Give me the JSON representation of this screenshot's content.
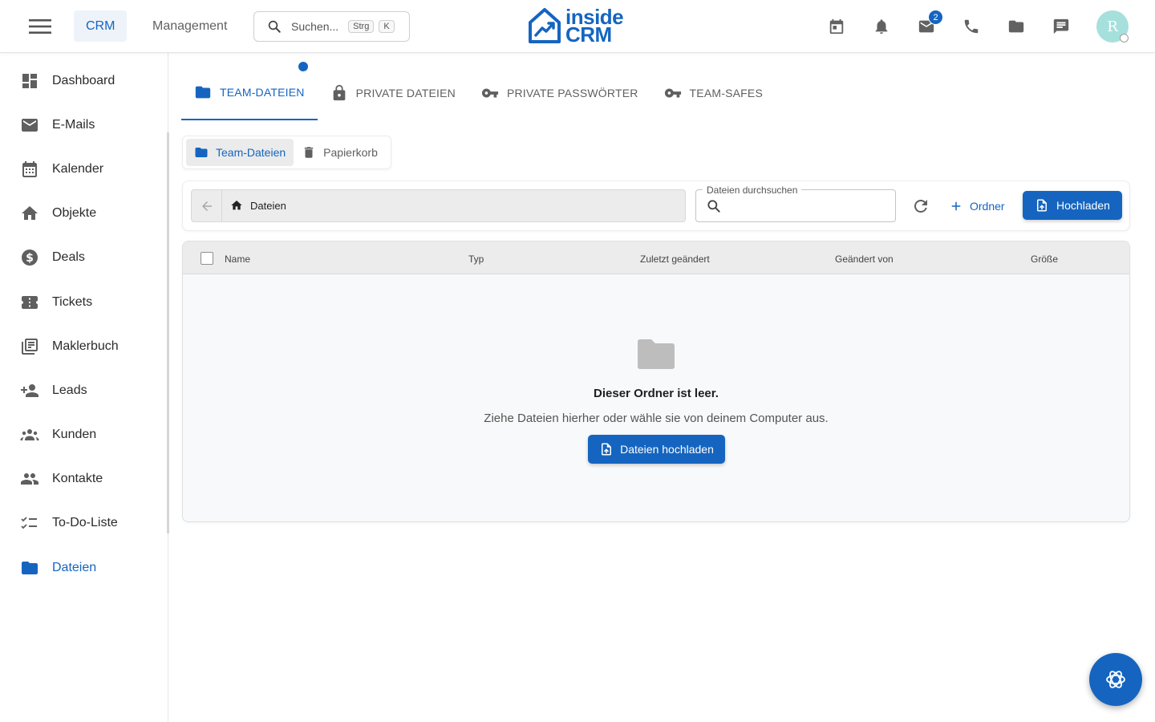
{
  "topbar": {
    "nav_tabs": [
      {
        "label": "CRM",
        "active": true
      },
      {
        "label": "Management",
        "active": false
      }
    ],
    "search": {
      "placeholder": "Suchen...",
      "shortcut_mod": "Strg",
      "shortcut_key": "K"
    },
    "logo": {
      "line1": "inside",
      "line2": "CRM"
    },
    "icons": [
      "calendar-icon",
      "bell-icon",
      "mail-icon",
      "phone-icon",
      "folder-icon",
      "chat-icon"
    ],
    "mail_badge": "2",
    "avatar_initial": "R"
  },
  "sidebar": {
    "items": [
      {
        "label": "Dashboard",
        "icon": "dashboard-icon"
      },
      {
        "label": "E-Mails",
        "icon": "mail-icon"
      },
      {
        "label": "Kalender",
        "icon": "calendar-icon"
      },
      {
        "label": "Objekte",
        "icon": "house-icon"
      },
      {
        "label": "Deals",
        "icon": "dollar-icon"
      },
      {
        "label": "Tickets",
        "icon": "ticket-icon"
      },
      {
        "label": "Maklerbuch",
        "icon": "library-icon"
      },
      {
        "label": "Leads",
        "icon": "person-add-icon"
      },
      {
        "label": "Kunden",
        "icon": "groups-icon"
      },
      {
        "label": "Kontakte",
        "icon": "people-icon"
      },
      {
        "label": "To-Do-Liste",
        "icon": "checklist-icon"
      },
      {
        "label": "Dateien",
        "icon": "folder-icon",
        "active": true
      }
    ]
  },
  "tabs": [
    {
      "label": "TEAM-DATEIEN",
      "icon": "folder-icon",
      "active": true
    },
    {
      "label": "PRIVATE DATEIEN",
      "icon": "lock-icon"
    },
    {
      "label": "PRIVATE PASSWÖRTER",
      "icon": "key-icon"
    },
    {
      "label": "TEAM-SAFES",
      "icon": "key-icon"
    }
  ],
  "subnav": [
    {
      "label": "Team-Dateien",
      "icon": "folder-icon",
      "active": true
    },
    {
      "label": "Papierkorb",
      "icon": "trash-icon"
    }
  ],
  "toolbar": {
    "breadcrumb": "Dateien",
    "search_label": "Dateien durchsuchen",
    "search_value": "",
    "new_folder_label": "Ordner",
    "upload_label": "Hochladen"
  },
  "table": {
    "columns": [
      "Name",
      "Typ",
      "Zuletzt geändert",
      "Geändert von",
      "Größe"
    ],
    "rows": [],
    "empty_title": "Dieser Ordner ist leer.",
    "empty_subtitle": "Ziehe Dateien hierher oder wähle sie von deinem Computer aus.",
    "empty_button": "Dateien hochladen"
  },
  "colors": {
    "primary": "#1565c0",
    "avatar": "#a5e0dc",
    "text": "#212121",
    "muted": "#616161"
  }
}
